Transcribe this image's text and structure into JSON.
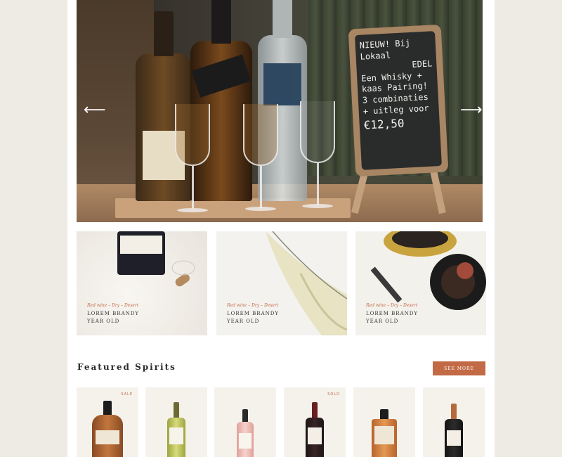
{
  "hero": {
    "chalkboard": [
      "NIEUW! Bij Lokaal",
      "EDEL",
      "Een Whisky +",
      "kaas Pairing!",
      "3 combinaties",
      "+ uitleg voor",
      "€12,50"
    ],
    "prev_arrow": "⟵",
    "next_arrow": "⟶"
  },
  "promos": [
    {
      "tag": "Red wine – Dry – Desert",
      "title": "Lorem Brandy",
      "subtitle": "Year Old"
    },
    {
      "tag": "Red wine – Dry – Desert",
      "title": "Lorem Brandy",
      "subtitle": "Year Old"
    },
    {
      "tag": "Red wine – Dry – Desert",
      "title": "Lorem Brandy",
      "subtitle": "Year Old"
    }
  ],
  "featured": {
    "title": "Featured Spirits",
    "see_more_label": "See more"
  },
  "products": [
    {
      "badge": "SALE"
    },
    {
      "badge": ""
    },
    {
      "badge": ""
    },
    {
      "badge": "SOLD"
    },
    {
      "badge": ""
    },
    {
      "badge": ""
    }
  ],
  "colors": {
    "accent": "#c26a45",
    "background": "#eeebe5",
    "card": "#f5f2ec"
  }
}
